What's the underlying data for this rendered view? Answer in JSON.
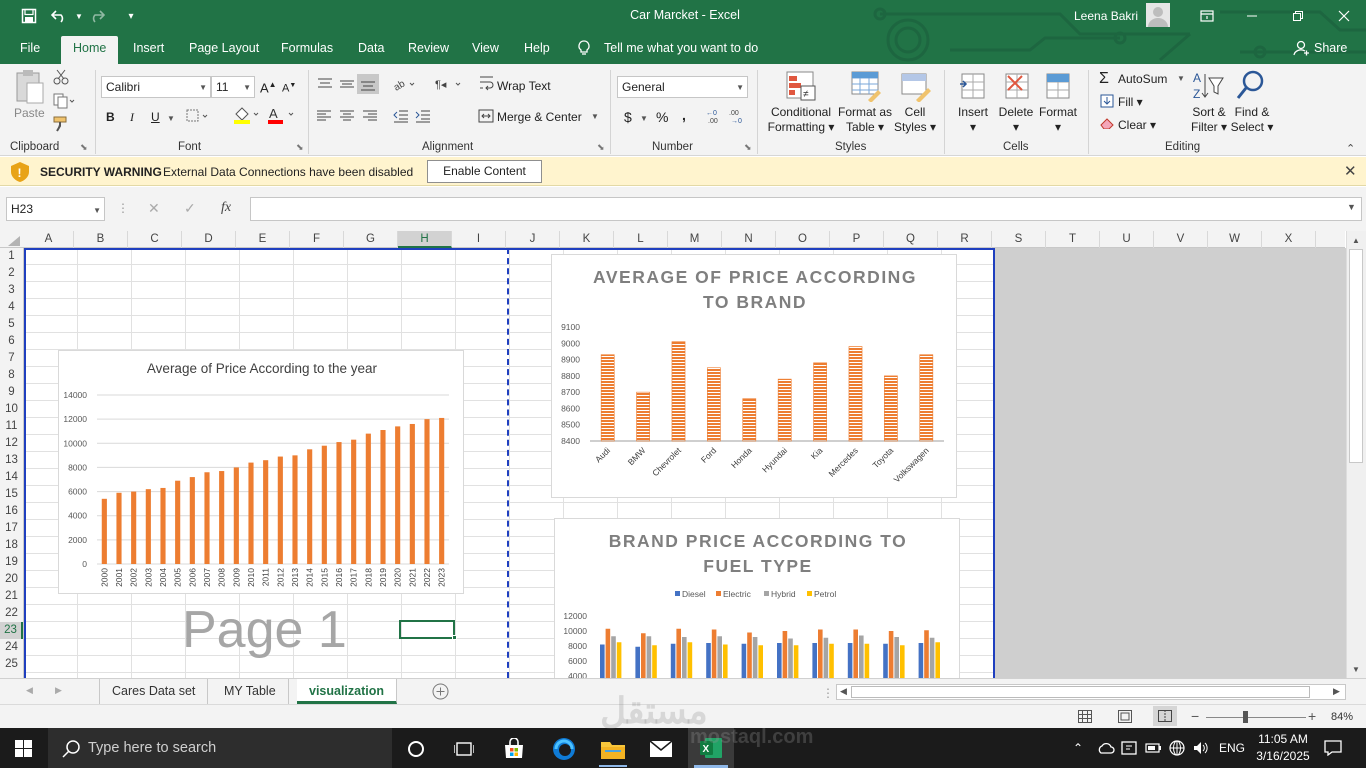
{
  "window": {
    "title": "Car Marcket  -  Excel",
    "user": "Leena Bakri"
  },
  "menu_tabs": [
    {
      "label": "File"
    },
    {
      "label": "Home"
    },
    {
      "label": "Insert"
    },
    {
      "label": "Page Layout"
    },
    {
      "label": "Formulas"
    },
    {
      "label": "Data"
    },
    {
      "label": "Review"
    },
    {
      "label": "View"
    },
    {
      "label": "Help"
    }
  ],
  "tell_me": "Tell me what you want to do",
  "share": "Share",
  "ribbon": {
    "clipboard": {
      "label": "Clipboard",
      "paste": "Paste"
    },
    "font": {
      "label": "Font",
      "name": "Calibri",
      "size": "11",
      "bold": "B",
      "italic": "I",
      "underline": "U"
    },
    "alignment": {
      "label": "Alignment",
      "wrap": "Wrap Text",
      "merge": "Merge & Center"
    },
    "number": {
      "label": "Number",
      "format": "General",
      "currency": "$",
      "percent": "%",
      "comma": ","
    },
    "styles": {
      "label": "Styles",
      "conditional": [
        "Conditional",
        "Formatting"
      ],
      "format_table": [
        "Format as",
        "Table"
      ],
      "cell_styles": [
        "Cell",
        "Styles"
      ]
    },
    "cells": {
      "label": "Cells",
      "insert": "Insert",
      "delete": "Delete",
      "format": "Format"
    },
    "editing": {
      "label": "Editing",
      "autosum": "AutoSum",
      "fill": "Fill",
      "clear": "Clear",
      "sort": [
        "Sort &",
        "Filter"
      ],
      "find": [
        "Find &",
        "Select"
      ]
    }
  },
  "security": {
    "title": "SECURITY WARNING",
    "message": "External Data Connections have been disabled",
    "button": "Enable Content"
  },
  "formula_bar": {
    "name_box": "H23",
    "fx": "fx",
    "value": ""
  },
  "columns": [
    "A",
    "B",
    "C",
    "D",
    "E",
    "F",
    "G",
    "H",
    "I",
    "J",
    "K",
    "L",
    "M",
    "N",
    "O",
    "P",
    "Q",
    "R",
    "S",
    "T",
    "U",
    "V",
    "W",
    "X"
  ],
  "rows": [
    "1",
    "2",
    "3",
    "4",
    "5",
    "6",
    "7",
    "8",
    "9",
    "10",
    "11",
    "12",
    "13",
    "14",
    "15",
    "16",
    "17",
    "18",
    "19",
    "20",
    "21",
    "22",
    "23",
    "24",
    "25"
  ],
  "page_watermark": "Page 1",
  "sheets": [
    {
      "label": "Cares Data set"
    },
    {
      "label": "MY Table"
    },
    {
      "label": "visualization"
    }
  ],
  "status": {
    "zoom": "84%"
  },
  "taskbar": {
    "search": "Type here to search",
    "lang": "ENG",
    "time": "11:05 AM",
    "date": "3/16/2025"
  },
  "colors": {
    "excel_green": "#217346",
    "bar_orange": "#ed7d31",
    "diesel": "#4472c4",
    "electric": "#ed7d31",
    "hybrid": "#a5a5a5",
    "petrol": "#ffc000"
  },
  "chart_data": [
    {
      "type": "bar",
      "title": "Average of Price According to the  year",
      "categories": [
        "2000",
        "2001",
        "2002",
        "2003",
        "2004",
        "2005",
        "2006",
        "2007",
        "2008",
        "2009",
        "2010",
        "2011",
        "2012",
        "2013",
        "2014",
        "2015",
        "2016",
        "2017",
        "2018",
        "2019",
        "2020",
        "2021",
        "2022",
        "2023"
      ],
      "values": [
        5400,
        5900,
        6000,
        6200,
        6300,
        6900,
        7200,
        7600,
        7700,
        8000,
        8400,
        8600,
        8900,
        9000,
        9500,
        9800,
        10100,
        10300,
        10800,
        11100,
        11400,
        11600,
        12000,
        12100
      ],
      "y_ticks": [
        "0",
        "2000",
        "4000",
        "6000",
        "8000",
        "10000",
        "12000",
        "14000"
      ],
      "ylim": [
        0,
        14000
      ]
    },
    {
      "type": "bar",
      "title": [
        "AVERAGE OF PRICE ACCORDING",
        "TO BRAND"
      ],
      "categories": [
        "Audi",
        "BMW",
        "Chevrolet",
        "Ford",
        "Honda",
        "Hyundai",
        "Kia",
        "Mercedes",
        "Toyota",
        "Volkswagen"
      ],
      "values": [
        8930,
        8700,
        9010,
        8850,
        8660,
        8780,
        8880,
        8980,
        8800,
        8930
      ],
      "y_ticks": [
        "8400",
        "8500",
        "8600",
        "8700",
        "8800",
        "8900",
        "9000",
        "9100"
      ],
      "ylim": [
        8400,
        9100
      ]
    },
    {
      "type": "bar",
      "title": [
        "BRAND PRICE ACCORDING TO",
        "FUEL TYPE"
      ],
      "legend": [
        "Diesel",
        "Electric",
        "Hybrid",
        "Petrol"
      ],
      "y_ticks": [
        "4000",
        "6000",
        "8000",
        "10000",
        "12000"
      ],
      "ylim": [
        4000,
        12000
      ],
      "series": [
        {
          "name": "Diesel",
          "values": [
            8200,
            7900,
            8300,
            8400,
            8300,
            8400,
            8400,
            8400,
            8300,
            8400
          ]
        },
        {
          "name": "Electric",
          "values": [
            10300,
            9700,
            10300,
            10200,
            9800,
            10000,
            10200,
            10200,
            10000,
            10100
          ]
        },
        {
          "name": "Hybrid",
          "values": [
            9300,
            9300,
            9200,
            9300,
            9200,
            9000,
            9100,
            9400,
            9200,
            9100
          ]
        },
        {
          "name": "Petrol",
          "values": [
            8500,
            8100,
            8500,
            8200,
            8100,
            8100,
            8300,
            8300,
            8100,
            8500
          ]
        }
      ]
    }
  ]
}
